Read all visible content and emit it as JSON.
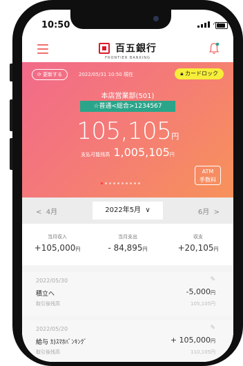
{
  "status_bar": {
    "time": "10:50"
  },
  "bank": {
    "name": "百五銀行",
    "name_en": "FRONTIER BANKING"
  },
  "hero": {
    "refresh_label": "更新する",
    "updated_at": "2022/05/31 10:50 現在",
    "card_lock_label": "カードロック",
    "branch": "本店営業部(501)",
    "account": "☆普通<総合>1234567",
    "balance": "105,105",
    "balance_unit": "円",
    "available_label": "支払可能残高",
    "available": "1,005,105",
    "available_unit": "円",
    "atm_line1": "ATM",
    "atm_line2": "手数料",
    "page_index": 1,
    "page_count": 10
  },
  "months": {
    "prev": "4月",
    "current": "2022年5月",
    "next": "6月"
  },
  "summary": {
    "income_label": "当月収入",
    "income": "+105,000",
    "expense_label": "当月支出",
    "expense": "- 84,895",
    "balance_label": "収支",
    "balance": "+20,105",
    "unit": "円"
  },
  "transactions": [
    {
      "date": "2022/05/30",
      "name": "積立へ",
      "amount": "-5,000",
      "unit": "円",
      "balance_label": "取引後残高",
      "balance": "105,105円"
    },
    {
      "date": "2022/05/20",
      "name": "給与 ｶ)ｽﾏﾎﾊﾞﾝｷﾝｸﾞ",
      "amount": "+ 105,000",
      "unit": "円",
      "balance_label": "取引後残高",
      "balance": "110,105円"
    }
  ],
  "colors": {
    "hero_gradient_start": "#f26a8a",
    "hero_gradient_end": "#f7925a",
    "account_badge": "#2aa58a",
    "card_lock": "#f6ee3a",
    "accent": "#ef6e6b"
  }
}
